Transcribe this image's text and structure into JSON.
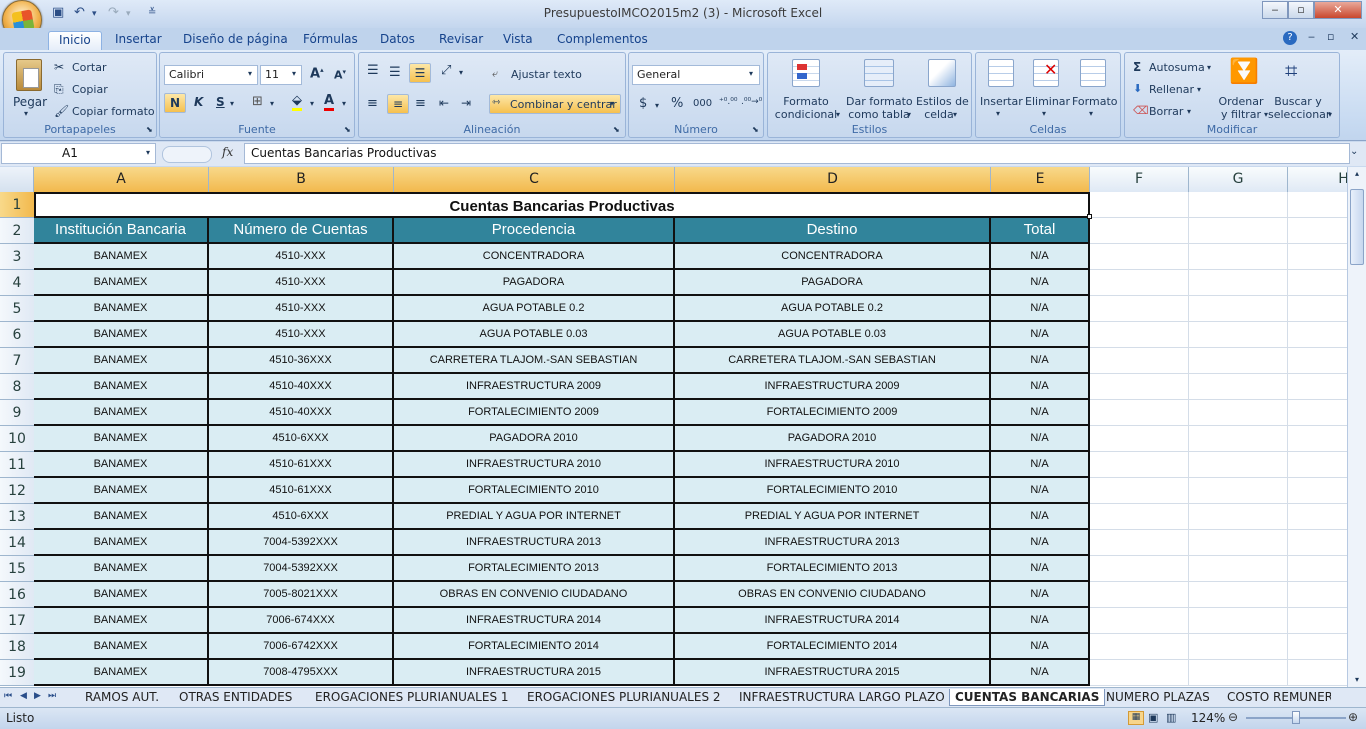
{
  "window": {
    "title": "PresupuestoIMCO2015m2 (3) - Microsoft Excel",
    "minimize": "‒",
    "maximize": "▫",
    "close": "✕"
  },
  "qat": {
    "save_icon": "save-icon",
    "undo_icon": "undo-icon",
    "redo_icon": "redo-icon"
  },
  "tabs": [
    "Inicio",
    "Insertar",
    "Diseño de página",
    "Fórmulas",
    "Datos",
    "Revisar",
    "Vista",
    "Complementos"
  ],
  "ribbon": {
    "portapapeles": {
      "label": "Portapapeles",
      "paste": "Pegar",
      "cut": "Cortar",
      "copy": "Copiar",
      "format_painter": "Copiar formato"
    },
    "fuente": {
      "label": "Fuente",
      "font": "Calibri",
      "size": "11",
      "bold": "N",
      "italic": "K",
      "underline": "S"
    },
    "alineacion": {
      "label": "Alineación",
      "wrap": "Ajustar texto",
      "merge": "Combinar y centrar"
    },
    "numero": {
      "label": "Número",
      "format": "General",
      "currency": "$",
      "percent": "%",
      "thousands": "000"
    },
    "estilos": {
      "label": "Estilos",
      "conditional": [
        "Formato",
        "condicional"
      ],
      "table": [
        "Dar formato",
        "como tabla"
      ],
      "cell_styles": [
        "Estilos de",
        "celda"
      ]
    },
    "celdas": {
      "label": "Celdas",
      "insert": "Insertar",
      "delete": "Eliminar",
      "format": "Formato"
    },
    "modificar": {
      "label": "Modificar",
      "autosum": "Autosuma",
      "fill": "Rellenar",
      "clear": "Borrar",
      "sort": [
        "Ordenar",
        "y filtrar"
      ],
      "find": [
        "Buscar y",
        "seleccionar"
      ]
    }
  },
  "formula_bar": {
    "name_box": "A1",
    "fx": "fx",
    "content": "Cuentas Bancarias Productivas"
  },
  "columns": [
    "A",
    "B",
    "C",
    "D",
    "E",
    "F",
    "G",
    "H"
  ],
  "sheet": {
    "title": "Cuentas Bancarias Productivas",
    "headers": [
      "Institución Bancaria",
      "Número de Cuentas",
      "Procedencia",
      "Destino",
      "Total"
    ],
    "rows": [
      [
        "BANAMEX",
        "4510-XXX",
        "CONCENTRADORA",
        "CONCENTRADORA",
        "N/A"
      ],
      [
        "BANAMEX",
        "4510-XXX",
        "PAGADORA",
        "PAGADORA",
        "N/A"
      ],
      [
        "BANAMEX",
        "4510-XXX",
        "AGUA POTABLE 0.2",
        "AGUA POTABLE 0.2",
        "N/A"
      ],
      [
        "BANAMEX",
        "4510-XXX",
        "AGUA POTABLE 0.03",
        "AGUA POTABLE 0.03",
        "N/A"
      ],
      [
        "BANAMEX",
        "4510-36XXX",
        "CARRETERA TLAJOM.-SAN SEBASTIAN",
        "CARRETERA TLAJOM.-SAN SEBASTIAN",
        "N/A"
      ],
      [
        "BANAMEX",
        "4510-40XXX",
        "INFRAESTRUCTURA 2009",
        "INFRAESTRUCTURA 2009",
        "N/A"
      ],
      [
        "BANAMEX",
        "4510-40XXX",
        "FORTALECIMIENTO 2009",
        "FORTALECIMIENTO 2009",
        "N/A"
      ],
      [
        "BANAMEX",
        "4510-6XXX",
        "PAGADORA 2010",
        "PAGADORA 2010",
        "N/A"
      ],
      [
        "BANAMEX",
        "4510-61XXX",
        "INFRAESTRUCTURA 2010",
        "INFRAESTRUCTURA 2010",
        "N/A"
      ],
      [
        "BANAMEX",
        "4510-61XXX",
        "FORTALECIMIENTO 2010",
        "FORTALECIMIENTO 2010",
        "N/A"
      ],
      [
        "BANAMEX",
        "4510-6XXX",
        "PREDIAL Y AGUA POR INTERNET",
        "PREDIAL Y AGUA POR INTERNET",
        "N/A"
      ],
      [
        "BANAMEX",
        "7004-5392XXX",
        "INFRAESTRUCTURA 2013",
        "INFRAESTRUCTURA 2013",
        "N/A"
      ],
      [
        "BANAMEX",
        "7004-5392XXX",
        "FORTALECIMIENTO 2013",
        "FORTALECIMIENTO 2013",
        "N/A"
      ],
      [
        "BANAMEX",
        "7005-8021XXX",
        "OBRAS EN CONVENIO CIUDADANO",
        "OBRAS EN CONVENIO CIUDADANO",
        "N/A"
      ],
      [
        "BANAMEX",
        "7006-674XXX",
        "INFRAESTRUCTURA 2014",
        "INFRAESTRUCTURA 2014",
        "N/A"
      ],
      [
        "BANAMEX",
        "7006-6742XXX",
        "FORTALECIMIENTO 2014",
        "FORTALECIMIENTO 2014",
        "N/A"
      ],
      [
        "BANAMEX",
        "7008-4795XXX",
        "INFRAESTRUCTURA 2015",
        "INFRAESTRUCTURA 2015",
        "N/A"
      ]
    ]
  },
  "sheet_tabs": [
    "RAMOS AUT.",
    "OTRAS ENTIDADES",
    "EROGACIONES PLURIANUALES 1",
    "EROGACIONES PLURIANUALES 2",
    "INFRAESTRUCTURA LARGO PLAZO",
    "CUENTAS BANCARIAS",
    "NUMERO PLAZAS",
    "COSTO REMUNERA"
  ],
  "active_sheet": "CUENTAS BANCARIAS",
  "status": {
    "mode": "Listo",
    "zoom": "124%"
  }
}
